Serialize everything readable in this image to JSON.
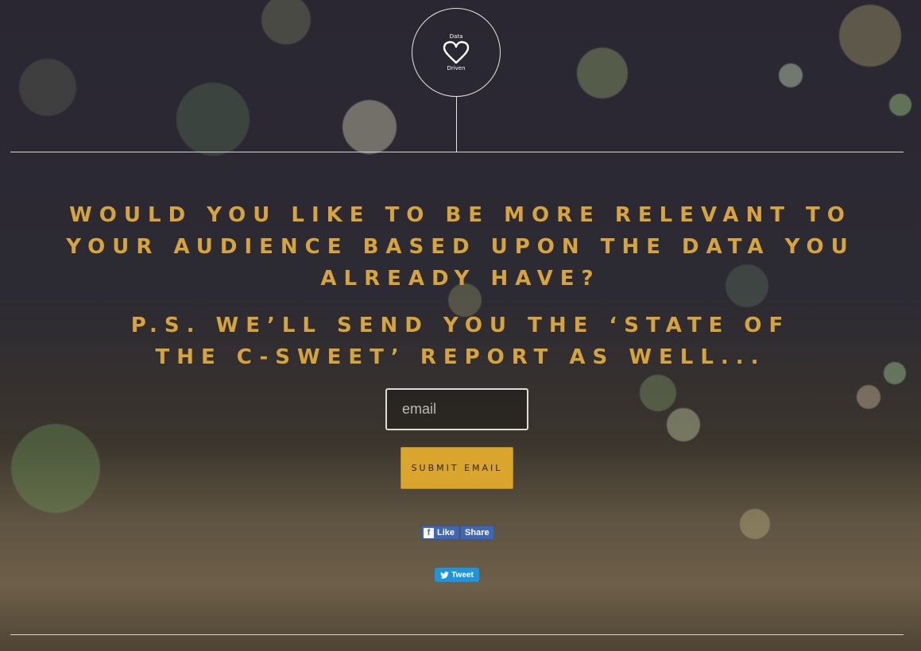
{
  "logo": {
    "top_text": "Data",
    "bottom_text": "Driven"
  },
  "headline": "WOULD YOU LIKE TO BE MORE RELEVANT TO YOUR AUDIENCE BASED UPON THE DATA YOU ALREADY HAVE?",
  "subheadline": "P.S. WE’LL SEND YOU THE ‘STATE OF THE C-SWEET’ REPORT AS WELL...",
  "form": {
    "email_placeholder": "email",
    "email_value": "",
    "submit_label": "SUBMIT EMAIL"
  },
  "social": {
    "facebook_icon_letter": "f",
    "facebook_like_label": "Like",
    "facebook_share_label": "Share",
    "tweet_label": "Tweet"
  },
  "colors": {
    "headline": "#d7a43a",
    "button": "#d9a52c",
    "facebook": "#4267b2",
    "twitter": "#1b95e0"
  },
  "icons": {
    "logo": "heart-icon",
    "facebook": "facebook-icon",
    "twitter": "twitter-bird-icon"
  }
}
